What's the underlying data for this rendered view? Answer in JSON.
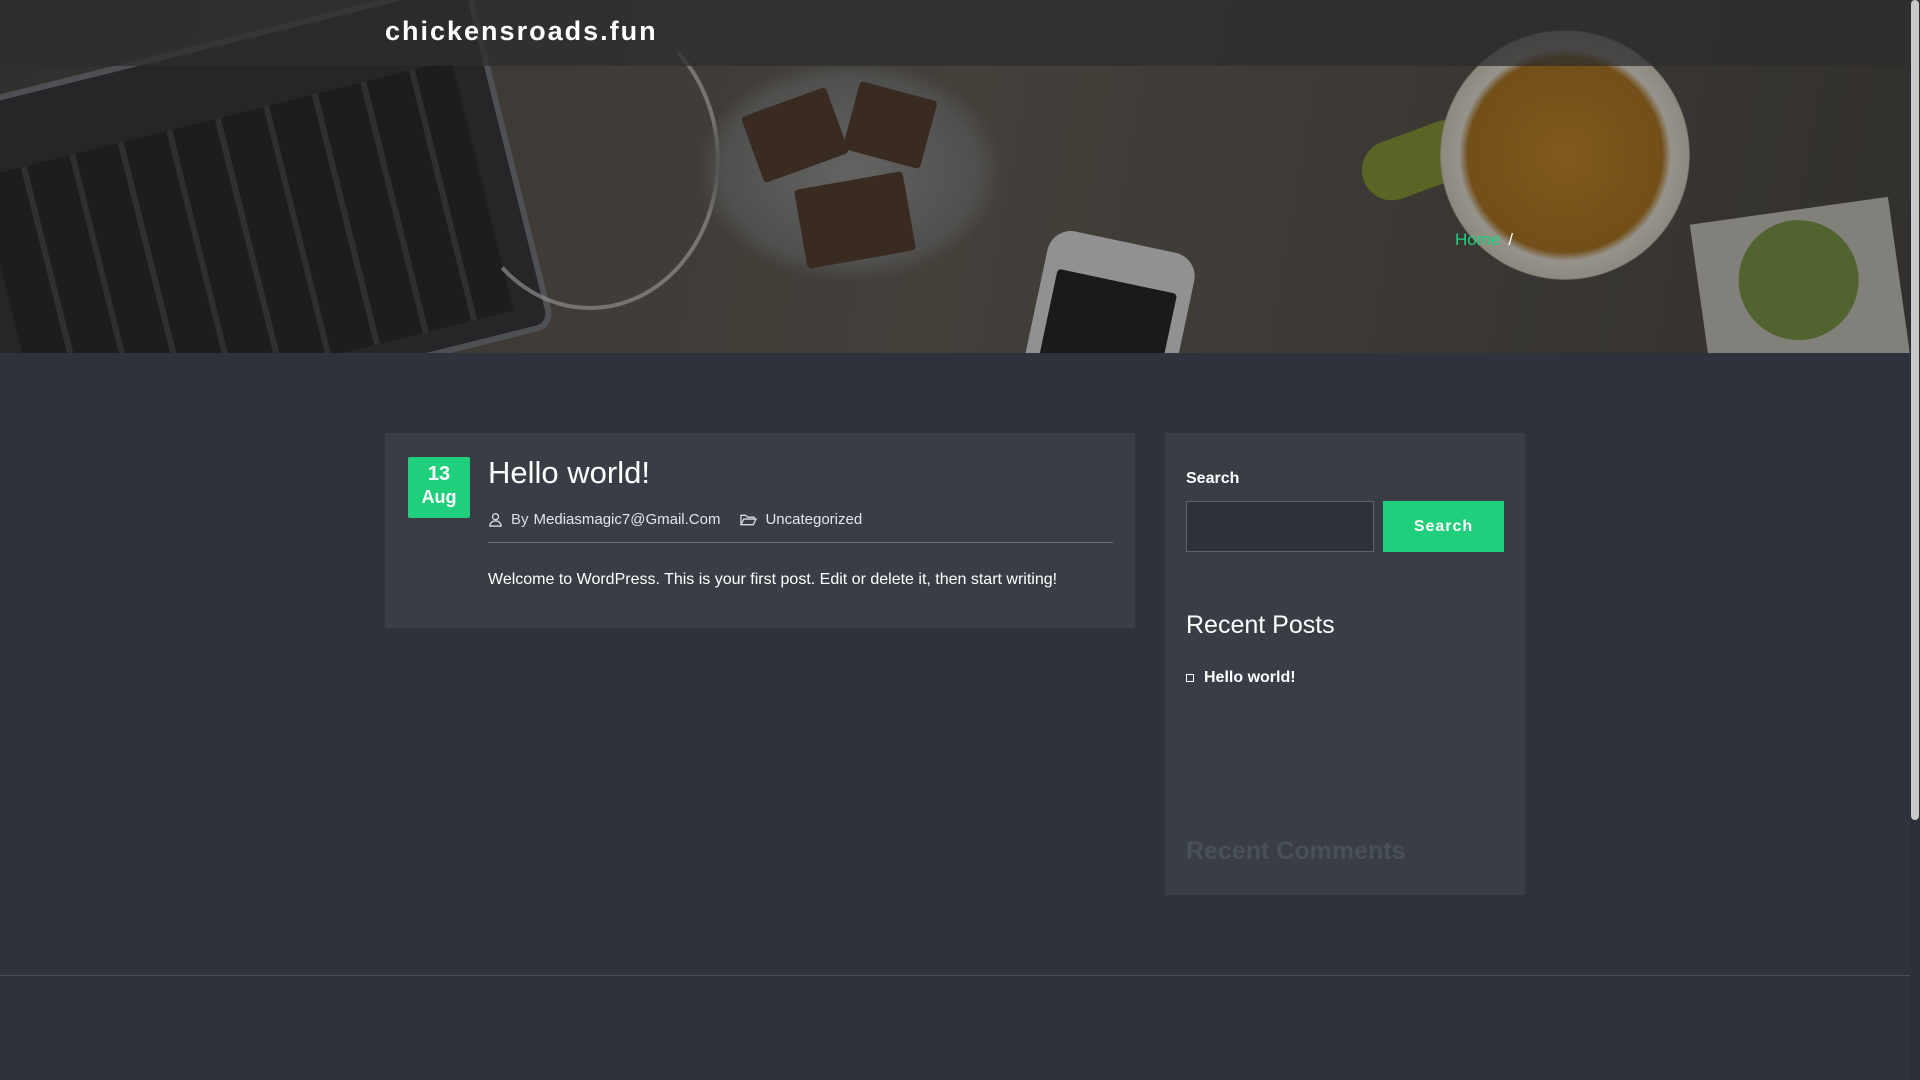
{
  "site": {
    "title": "chickensroads.fun"
  },
  "breadcrumb": {
    "home": "Home",
    "separator": "/"
  },
  "post": {
    "date_day": "13",
    "date_month": "Aug",
    "title": "Hello world!",
    "author_prefix": "By",
    "author": "Mediasmagic7@Gmail.Com",
    "category": "Uncategorized",
    "excerpt": "Welcome to WordPress. This is your first post. Edit or delete it, then start writing!"
  },
  "sidebar": {
    "search_label": "Search",
    "search_value": "",
    "search_button": "Search",
    "recent_posts_title": "Recent Posts",
    "recent_posts": [
      {
        "title": "Hello world!"
      }
    ],
    "faded_title": "Recent Comments"
  },
  "colors": {
    "accent": "#1fcf7c",
    "background": "#2e333b",
    "card": "#393e46"
  },
  "icons": {
    "author": "user-icon",
    "category": "folder-open-icon"
  }
}
